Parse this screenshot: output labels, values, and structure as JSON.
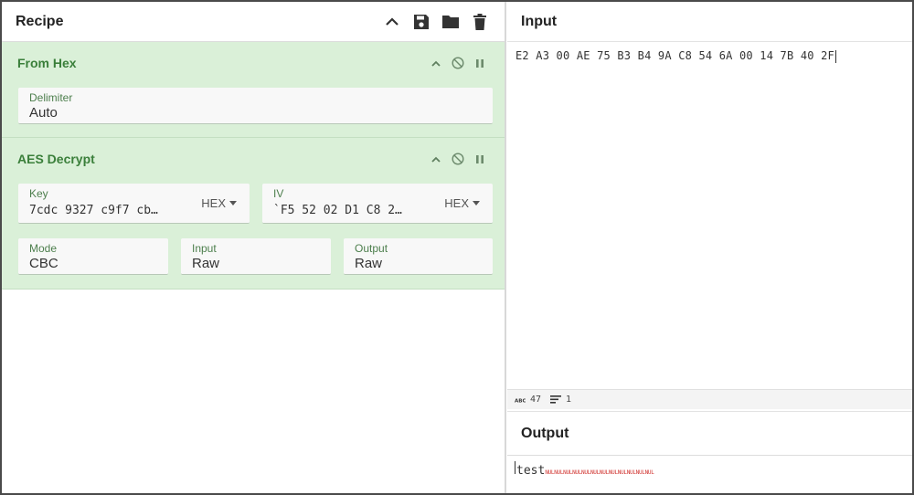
{
  "recipe": {
    "title": "Recipe",
    "icons": [
      "chevron-up-icon",
      "save-icon",
      "folder-icon",
      "trash-icon"
    ]
  },
  "operations": [
    {
      "title": "From Hex",
      "fields": {
        "delimiter": {
          "label": "Delimiter",
          "value": "Auto"
        }
      }
    },
    {
      "title": "AES Decrypt",
      "fields": {
        "key": {
          "label": "Key",
          "value": "7cdc 9327 c9f7 cb…",
          "format": "HEX"
        },
        "iv": {
          "label": "IV",
          "value": "`F5 52 02 D1 C8 2…",
          "format": "HEX"
        },
        "mode": {
          "label": "Mode",
          "value": "CBC"
        },
        "input": {
          "label": "Input",
          "value": "Raw"
        },
        "output": {
          "label": "Output",
          "value": "Raw"
        }
      }
    }
  ],
  "input": {
    "title": "Input",
    "text": "E2 A3 00 AE 75 B3 B4 9A C8 54 6A 00 14 7B 40 2F",
    "status": {
      "length": "47",
      "lines": "1"
    }
  },
  "output": {
    "title": "Output",
    "text": "test",
    "nul_chars": "NULNULNULNULNULNULNULNULNULNULNULNUL"
  },
  "colors": {
    "op_background": "#daf0d8",
    "op_title": "#3a7f3a",
    "nul_red": "#d0312d"
  }
}
